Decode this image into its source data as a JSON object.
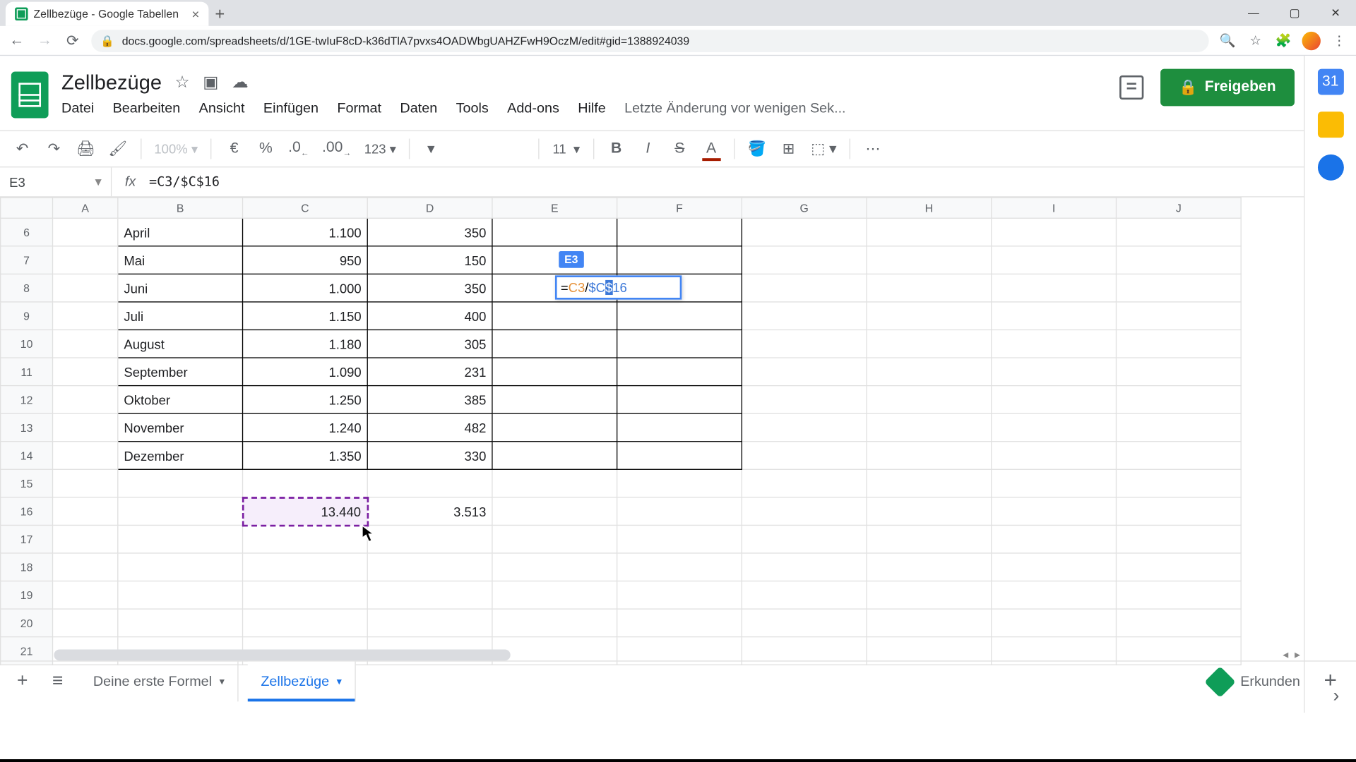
{
  "browser": {
    "tab_title": "Zellbezüge - Google Tabellen",
    "url": "docs.google.com/spreadsheets/d/1GE-twIuF8cD-k36dTlA7pvxs4OADWbgUAHZFwH9OczM/edit#gid=1388924039"
  },
  "app": {
    "doc_title": "Zellbezüge",
    "menus": [
      "Datei",
      "Bearbeiten",
      "Ansicht",
      "Einfügen",
      "Format",
      "Daten",
      "Tools",
      "Add-ons",
      "Hilfe"
    ],
    "last_edit": "Letzte Änderung vor wenigen Sek...",
    "share_label": "Freigeben"
  },
  "toolbar": {
    "zoom": "100%",
    "currency": "€",
    "percent": "%",
    "dec_less": ".0",
    "dec_more": ".00",
    "num_format": "123",
    "font_size": "11"
  },
  "formula_bar": {
    "name_box": "E3",
    "fx": "fx",
    "formula": "=C3/$C$16"
  },
  "grid": {
    "columns": [
      "A",
      "B",
      "C",
      "D",
      "E",
      "F",
      "G",
      "H",
      "I",
      "J"
    ],
    "row_numbers": [
      6,
      7,
      8,
      9,
      10,
      11,
      12,
      13,
      14,
      15,
      16,
      17,
      18,
      19,
      20,
      21
    ],
    "rows": [
      {
        "b": "April",
        "c": "1.100",
        "d": "350"
      },
      {
        "b": "Mai",
        "c": "950",
        "d": "150"
      },
      {
        "b": "Juni",
        "c": "1.000",
        "d": "350"
      },
      {
        "b": "Juli",
        "c": "1.150",
        "d": "400"
      },
      {
        "b": "August",
        "c": "1.180",
        "d": "305"
      },
      {
        "b": "September",
        "c": "1.090",
        "d": "231"
      },
      {
        "b": "Oktober",
        "c": "1.250",
        "d": "385"
      },
      {
        "b": "November",
        "c": "1.240",
        "d": "482"
      },
      {
        "b": "Dezember",
        "c": "1.350",
        "d": "330"
      }
    ],
    "row16": {
      "c": "13.440",
      "d": "3.513"
    },
    "edit_ref_tag": "E3",
    "edit_formula_parts": {
      "prefix": "=",
      "ref1": "C3",
      "op": "/",
      "ref2_pre": "$C",
      "ref2_hl": "$",
      "ref2_post": "16"
    }
  },
  "footer": {
    "tab1": "Deine erste Formel",
    "tab2": "Zellbezüge",
    "explore": "Erkunden"
  }
}
